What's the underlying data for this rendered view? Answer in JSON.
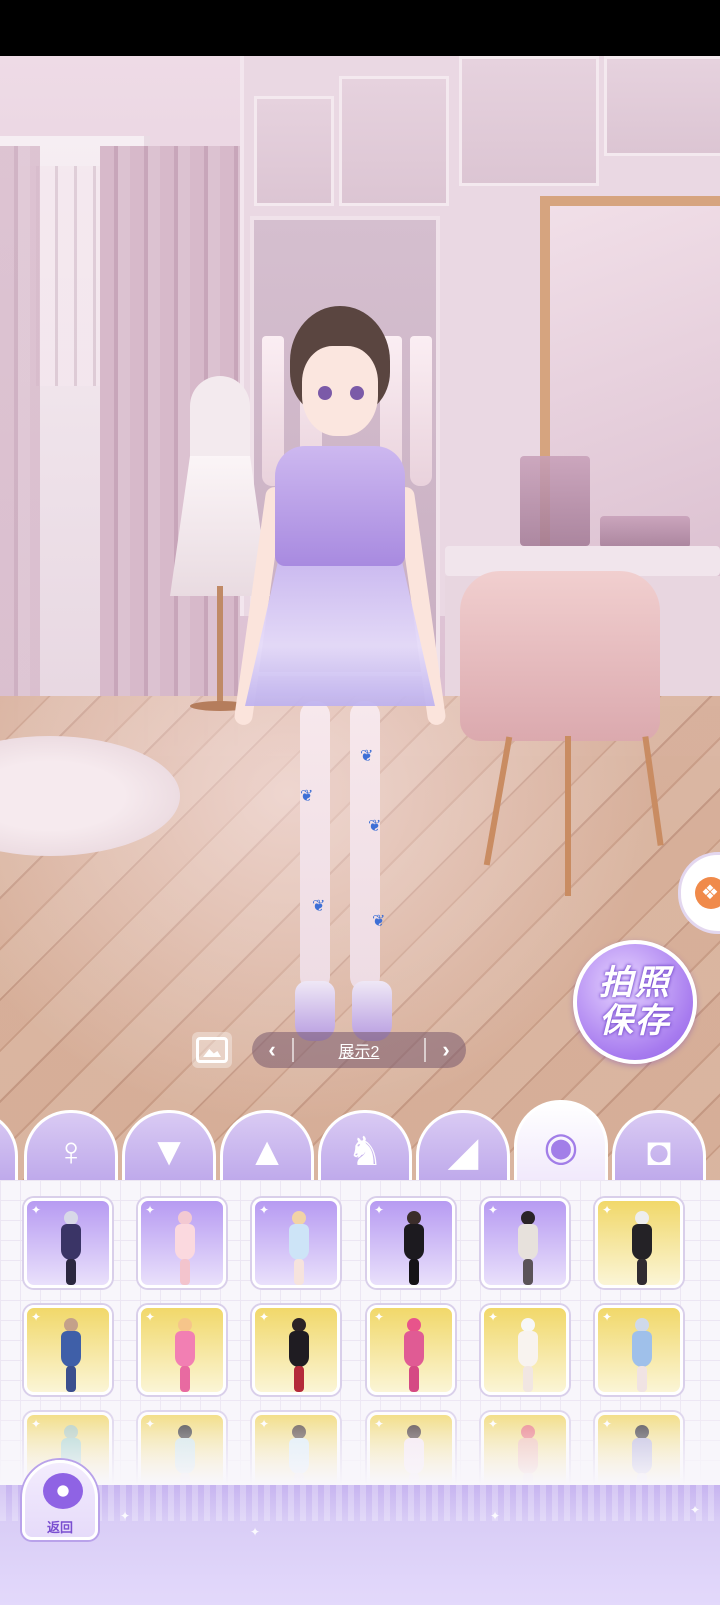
{
  "scene": {
    "photo_save": {
      "line1": "拍照",
      "line2": "保存"
    },
    "outfit_selector": {
      "label": "展示2",
      "prev_glyph": "‹",
      "next_glyph": "›"
    }
  },
  "category_tabs": [
    {
      "name": "hair-tab",
      "icon": "hair-icon",
      "active": false
    },
    {
      "name": "dress-tab",
      "icon": "dress-icon",
      "active": false
    },
    {
      "name": "top-tab",
      "icon": "shirt-icon",
      "active": false
    },
    {
      "name": "skirt-tab",
      "icon": "skirt-icon",
      "active": false
    },
    {
      "name": "socks-tab",
      "icon": "socks-icon",
      "active": false
    },
    {
      "name": "shoes-tab",
      "icon": "high-heel-icon",
      "active": false
    },
    {
      "name": "accessory-tab",
      "icon": "mask-icon",
      "active": true
    },
    {
      "name": "bag-tab",
      "icon": "handbag-icon",
      "active": false
    }
  ],
  "items": [
    {
      "bg": "purple",
      "hair": "#d8d8e8",
      "body": "#3a3466",
      "legs": "#2b2740"
    },
    {
      "bg": "purple",
      "hair": "#f3c9d2",
      "body": "#fbd9df",
      "legs": "#f3c4cd"
    },
    {
      "bg": "purple",
      "hair": "#f2d3a6",
      "body": "#cde4f7",
      "legs": "#f6e3dd"
    },
    {
      "bg": "purple",
      "hair": "#3b2d2b",
      "body": "#1c1a1f",
      "legs": "#151317"
    },
    {
      "bg": "purple",
      "hair": "#2a2327",
      "body": "#e7e1dc",
      "legs": "#5b5359"
    },
    {
      "bg": "yellow",
      "hair": "#eeeeee",
      "body": "#242226",
      "legs": "#302b31"
    },
    {
      "bg": "yellow",
      "hair": "#c4a18a",
      "body": "#3f5fa8",
      "legs": "#3b4f8e"
    },
    {
      "bg": "yellow",
      "hair": "#f6c58a",
      "body": "#f27fb3",
      "legs": "#e86aa1"
    },
    {
      "bg": "yellow",
      "hair": "#2c2326",
      "body": "#1f1c22",
      "legs": "#b42a3a"
    },
    {
      "bg": "yellow",
      "hair": "#e8548b",
      "body": "#e05b94",
      "legs": "#d54a84"
    },
    {
      "bg": "yellow",
      "hair": "#f7f7f7",
      "body": "#f8f3ef",
      "legs": "#f1e6e2"
    },
    {
      "bg": "yellow",
      "hair": "#cfd9ea",
      "body": "#9fc0ea",
      "legs": "#f0e3e3"
    },
    {
      "bg": "yellow",
      "hair": "#a9c8b8",
      "body": "#9fd0c8",
      "legs": "#e6d8cc"
    },
    {
      "bg": "yellow",
      "hair": "#2b2a2c",
      "body": "#c9e4e4",
      "legs": "#e8e0dc"
    },
    {
      "bg": "yellow",
      "hair": "#4a3a32",
      "body": "#d7ecf5",
      "legs": "#efe4de"
    },
    {
      "bg": "yellow",
      "hair": "#3a2b2a",
      "body": "#f6e6ef",
      "legs": "#f2e2e8"
    },
    {
      "bg": "yellow",
      "hair": "#e86f78",
      "body": "#f0b8a8",
      "legs": "#eed6cc"
    },
    {
      "bg": "yellow",
      "hair": "#2e2a30",
      "body": "#b3b0d9",
      "legs": "#e5dfe8"
    }
  ],
  "bottom_bar": {
    "back_label": "返回"
  },
  "colors": {
    "accent": "#a77bef",
    "tab": "#c7b4ee",
    "panel": "#f8f6fb"
  }
}
